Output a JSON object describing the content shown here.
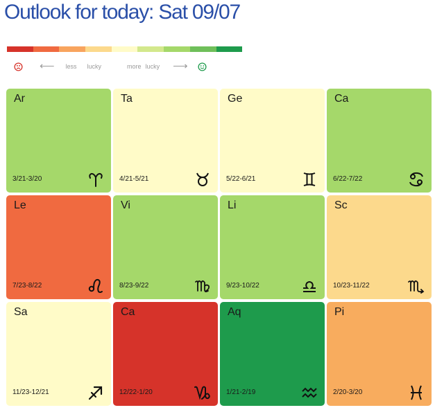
{
  "header": {
    "title": "Outlook for today: Sat 09/07"
  },
  "scale": {
    "colors": [
      "#d6332a",
      "#f06a40",
      "#f8a45e",
      "#fcd98c",
      "#fffbc8",
      "#d3e88c",
      "#a5d86a",
      "#6fbf5a",
      "#1e9b4c"
    ]
  },
  "legend": {
    "sad_icon": "sad-face-icon",
    "happy_icon": "smiley-face-icon",
    "left_arrow": "⟵",
    "less_label": "less",
    "lucky_label_1": "lucky",
    "more_label": "more",
    "lucky_label_2": "lucky",
    "right_arrow": "⟶"
  },
  "signs": [
    {
      "abbr": "Ar",
      "dates": "3/21-3/20",
      "icon": "aries-icon",
      "color": "#a5d86a"
    },
    {
      "abbr": "Ta",
      "dates": "4/21-5/21",
      "icon": "taurus-icon",
      "color": "#fffbc8"
    },
    {
      "abbr": "Ge",
      "dates": "5/22-6/21",
      "icon": "gemini-icon",
      "color": "#fffbc8"
    },
    {
      "abbr": "Ca",
      "dates": "6/22-7/22",
      "icon": "cancer-icon",
      "color": "#a5d86a"
    },
    {
      "abbr": "Le",
      "dates": "7/23-8/22",
      "icon": "leo-icon",
      "color": "#f06a40"
    },
    {
      "abbr": "Vi",
      "dates": "8/23-9/22",
      "icon": "virgo-icon",
      "color": "#a5d86a"
    },
    {
      "abbr": "Li",
      "dates": "9/23-10/22",
      "icon": "libra-icon",
      "color": "#a5d86a"
    },
    {
      "abbr": "Sc",
      "dates": "10/23-11/22",
      "icon": "scorpio-icon",
      "color": "#fcd98c"
    },
    {
      "abbr": "Sa",
      "dates": "11/23-12/21",
      "icon": "sagittarius-icon",
      "color": "#fffbc8"
    },
    {
      "abbr": "Ca",
      "dates": "12/22-1/20",
      "icon": "capricorn-icon",
      "color": "#d6332a"
    },
    {
      "abbr": "Aq",
      "dates": "1/21-2/19",
      "icon": "aquarius-icon",
      "color": "#1e9b4c"
    },
    {
      "abbr": "Pi",
      "dates": "2/20-3/20",
      "icon": "pisces-icon",
      "color": "#f8ac5e"
    }
  ]
}
